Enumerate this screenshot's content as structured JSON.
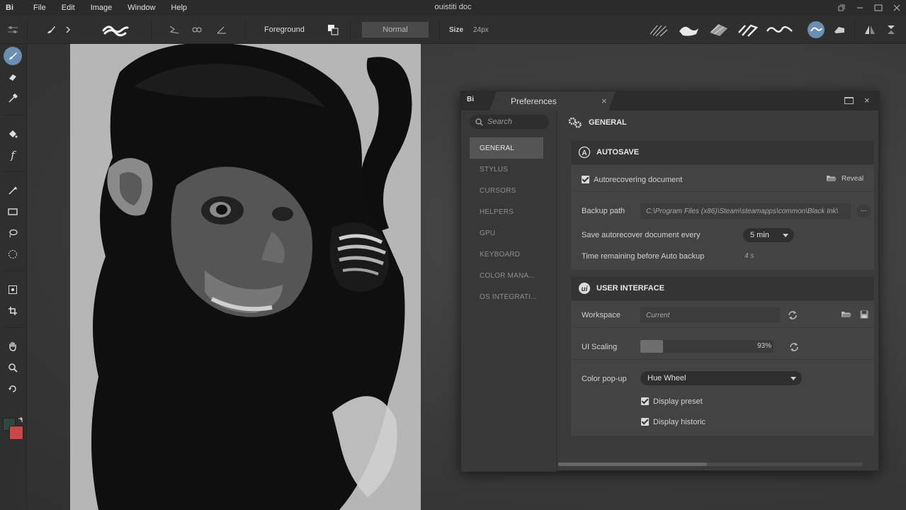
{
  "app": {
    "logo": "Bi",
    "document_title": "ouistiti doc",
    "menu": [
      "File",
      "Edit",
      "Image",
      "Window",
      "Help"
    ]
  },
  "optionsbar": {
    "foreground_label": "Foreground",
    "blend_mode": "Normal",
    "size_label": "Size",
    "size_value": "24px"
  },
  "colors": {
    "foreground": "#2d4a3c",
    "background": "#c84848",
    "active_tool": "#6a8fb3"
  },
  "preferences": {
    "logo": "Bi",
    "title": "Preferences",
    "search_placeholder": "Search",
    "categories": [
      "GENERAL",
      "STYLUS",
      "CURSORS",
      "HELPERS",
      "GPU",
      "KEYBOARD",
      "COLOR MANA...",
      "OS INTEGRATI..."
    ],
    "active_category": "GENERAL",
    "page_title": "GENERAL",
    "autosave": {
      "title": "AUTOSAVE",
      "autorecover_label": "Autorecovering document",
      "autorecover_checked": true,
      "reveal_label": "Reveal",
      "backup_path_label": "Backup path",
      "backup_path_value": "C:\\Program Files (x86)\\Steam\\steamapps\\common\\Black Ink\\",
      "browse_label": "...",
      "save_every_label": "Save autorecover document every",
      "save_every_value": "5 min",
      "time_remaining_label": "Time remaining before Auto backup",
      "time_remaining_value": "4 s"
    },
    "ui": {
      "title": "USER INTERFACE",
      "workspace_label": "Workspace",
      "workspace_value": "Current",
      "scaling_label": "UI Scaling",
      "scaling_value": "93%",
      "scaling_fraction": 0.17,
      "color_popup_label": "Color pop-up",
      "color_popup_value": "Hue Wheel",
      "display_preset_label": "Display preset",
      "display_preset_checked": true,
      "display_historic_label": "Display historic",
      "display_historic_checked": true
    }
  }
}
